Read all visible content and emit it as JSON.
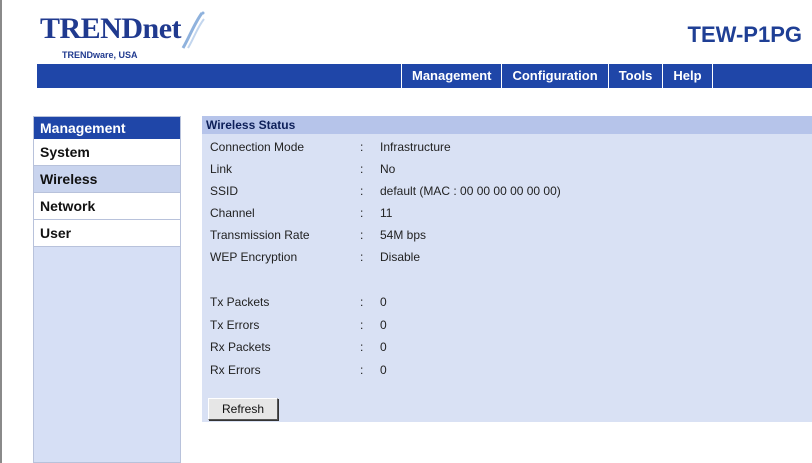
{
  "brand": {
    "logo_text": "TRENDnet",
    "logo_subtitle": "TRENDware, USA",
    "model": "TEW-P1PG",
    "brand_color": "#203a8f",
    "accent_color": "#1f46a8"
  },
  "nav": {
    "items": [
      {
        "label": "Management"
      },
      {
        "label": "Configuration"
      },
      {
        "label": "Tools"
      },
      {
        "label": "Help"
      }
    ]
  },
  "sidebar": {
    "header": "Management",
    "items": [
      {
        "label": "System",
        "active": false
      },
      {
        "label": "Wireless",
        "active": true
      },
      {
        "label": "Network",
        "active": false
      },
      {
        "label": "User",
        "active": false
      }
    ]
  },
  "main": {
    "title": "Wireless Status",
    "separator": ":",
    "fields": [
      {
        "label": "Connection Mode",
        "value": "Infrastructure"
      },
      {
        "label": "Link",
        "value": "No"
      },
      {
        "label": "SSID",
        "value": "default (MAC : 00 00 00 00 00 00)"
      },
      {
        "label": "Channel",
        "value": "11"
      },
      {
        "label": "Transmission Rate",
        "value": "54M bps"
      },
      {
        "label": "WEP Encryption",
        "value": "Disable"
      }
    ],
    "stats": [
      {
        "label": "Tx Packets",
        "value": "0"
      },
      {
        "label": "Tx Errors",
        "value": "0"
      },
      {
        "label": "Rx Packets",
        "value": "0"
      },
      {
        "label": "Rx Errors",
        "value": "0"
      }
    ],
    "refresh_label": "Refresh"
  }
}
